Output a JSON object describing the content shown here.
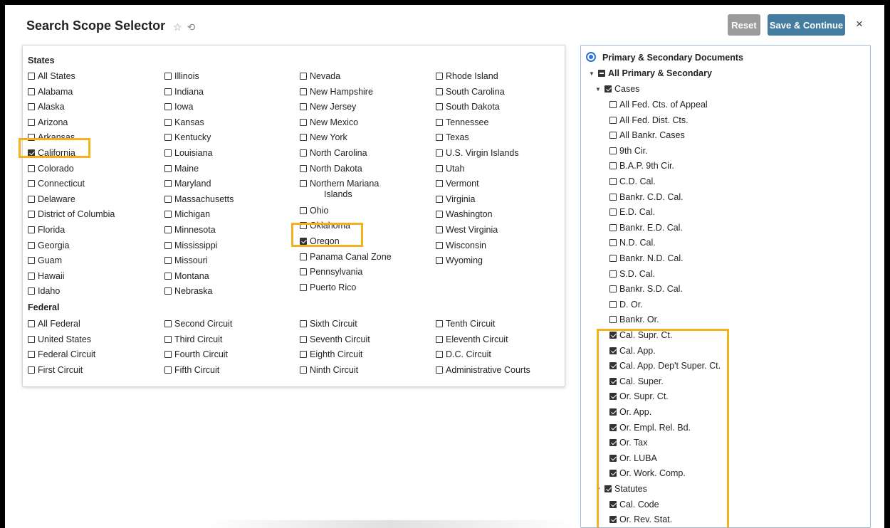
{
  "header": {
    "title": "Search Scope Selector",
    "star_icon": "star-icon",
    "history_icon": "history-icon",
    "reset_label": "Reset",
    "save_label": "Save & Continue",
    "close_label": "×"
  },
  "states": {
    "heading": "States",
    "col1": [
      {
        "label": "All States",
        "checked": false
      },
      {
        "label": "Alabama",
        "checked": false
      },
      {
        "label": "Alaska",
        "checked": false
      },
      {
        "label": "Arizona",
        "checked": false
      },
      {
        "label": "Arkansas",
        "checked": false
      },
      {
        "label": "California",
        "checked": true
      },
      {
        "label": "Colorado",
        "checked": false
      },
      {
        "label": "Connecticut",
        "checked": false
      },
      {
        "label": "Delaware",
        "checked": false
      },
      {
        "label": "District of Columbia",
        "checked": false
      },
      {
        "label": "Florida",
        "checked": false
      },
      {
        "label": "Georgia",
        "checked": false
      },
      {
        "label": "Guam",
        "checked": false
      },
      {
        "label": "Hawaii",
        "checked": false
      },
      {
        "label": "Idaho",
        "checked": false
      }
    ],
    "col2": [
      {
        "label": "Illinois",
        "checked": false
      },
      {
        "label": "Indiana",
        "checked": false
      },
      {
        "label": "Iowa",
        "checked": false
      },
      {
        "label": "Kansas",
        "checked": false
      },
      {
        "label": "Kentucky",
        "checked": false
      },
      {
        "label": "Louisiana",
        "checked": false
      },
      {
        "label": "Maine",
        "checked": false
      },
      {
        "label": "Maryland",
        "checked": false
      },
      {
        "label": "Massachusetts",
        "checked": false
      },
      {
        "label": "Michigan",
        "checked": false
      },
      {
        "label": "Minnesota",
        "checked": false
      },
      {
        "label": "Mississippi",
        "checked": false
      },
      {
        "label": "Missouri",
        "checked": false
      },
      {
        "label": "Montana",
        "checked": false
      },
      {
        "label": "Nebraska",
        "checked": false
      }
    ],
    "col3": [
      {
        "label": "Nevada",
        "checked": false
      },
      {
        "label": "New Hampshire",
        "checked": false
      },
      {
        "label": "New Jersey",
        "checked": false
      },
      {
        "label": "New Mexico",
        "checked": false
      },
      {
        "label": "New York",
        "checked": false
      },
      {
        "label": "North Carolina",
        "checked": false
      },
      {
        "label": "North Dakota",
        "checked": false
      },
      {
        "label": "Northern Mariana",
        "label2": "Islands",
        "checked": false
      },
      {
        "label": "Ohio",
        "checked": false
      },
      {
        "label": "Oklahoma",
        "checked": false
      },
      {
        "label": "Oregon",
        "checked": true
      },
      {
        "label": "Panama Canal Zone",
        "checked": false
      },
      {
        "label": "Pennsylvania",
        "checked": false
      },
      {
        "label": "Puerto Rico",
        "checked": false
      }
    ],
    "col4": [
      {
        "label": "Rhode Island",
        "checked": false
      },
      {
        "label": "South Carolina",
        "checked": false
      },
      {
        "label": "South Dakota",
        "checked": false
      },
      {
        "label": "Tennessee",
        "checked": false
      },
      {
        "label": "Texas",
        "checked": false
      },
      {
        "label": "U.S. Virgin Islands",
        "checked": false
      },
      {
        "label": "Utah",
        "checked": false
      },
      {
        "label": "Vermont",
        "checked": false
      },
      {
        "label": "Virginia",
        "checked": false
      },
      {
        "label": "Washington",
        "checked": false
      },
      {
        "label": "West Virginia",
        "checked": false
      },
      {
        "label": "Wisconsin",
        "checked": false
      },
      {
        "label": "Wyoming",
        "checked": false
      }
    ]
  },
  "federal": {
    "heading": "Federal",
    "col1": [
      {
        "label": "All Federal",
        "checked": false
      },
      {
        "label": "United States",
        "checked": false
      },
      {
        "label": "Federal Circuit",
        "checked": false
      },
      {
        "label": "First Circuit",
        "checked": false
      }
    ],
    "col2": [
      {
        "label": "Second Circuit",
        "checked": false
      },
      {
        "label": "Third Circuit",
        "checked": false
      },
      {
        "label": "Fourth Circuit",
        "checked": false
      },
      {
        "label": "Fifth Circuit",
        "checked": false
      }
    ],
    "col3": [
      {
        "label": "Sixth Circuit",
        "checked": false
      },
      {
        "label": "Seventh Circuit",
        "checked": false
      },
      {
        "label": "Eighth Circuit",
        "checked": false
      },
      {
        "label": "Ninth Circuit",
        "checked": false
      }
    ],
    "col4": [
      {
        "label": "Tenth Circuit",
        "checked": false
      },
      {
        "label": "Eleventh Circuit",
        "checked": false
      },
      {
        "label": "D.C. Circuit",
        "checked": false
      },
      {
        "label": "Administrative Courts",
        "checked": false
      }
    ]
  },
  "tree": {
    "radio_label": "Primary & Secondary Documents",
    "root": {
      "label": "All Primary & Secondary",
      "state": "partial"
    },
    "cases": {
      "label": "Cases",
      "state": "checked"
    },
    "case_items": [
      {
        "label": "All Fed. Cts. of Appeal",
        "checked": false
      },
      {
        "label": "All Fed. Dist. Cts.",
        "checked": false
      },
      {
        "label": "All Bankr. Cases",
        "checked": false
      },
      {
        "label": "9th Cir.",
        "checked": false
      },
      {
        "label": "B.A.P. 9th Cir.",
        "checked": false
      },
      {
        "label": "C.D. Cal.",
        "checked": false
      },
      {
        "label": "Bankr. C.D. Cal.",
        "checked": false
      },
      {
        "label": "E.D. Cal.",
        "checked": false
      },
      {
        "label": "Bankr. E.D. Cal.",
        "checked": false
      },
      {
        "label": "N.D. Cal.",
        "checked": false
      },
      {
        "label": "Bankr. N.D. Cal.",
        "checked": false
      },
      {
        "label": "S.D. Cal.",
        "checked": false
      },
      {
        "label": "Bankr. S.D. Cal.",
        "checked": false
      },
      {
        "label": "D. Or.",
        "checked": false
      },
      {
        "label": "Bankr. Or.",
        "checked": false
      },
      {
        "label": "Cal. Supr. Ct.",
        "checked": true
      },
      {
        "label": "Cal. App.",
        "checked": true
      },
      {
        "label": "Cal. App. Dep't Super. Ct.",
        "checked": true
      },
      {
        "label": "Cal. Super.",
        "checked": true
      },
      {
        "label": "Or. Supr. Ct.",
        "checked": true
      },
      {
        "label": "Or. App.",
        "checked": true
      },
      {
        "label": "Or. Empl. Rel. Bd.",
        "checked": true
      },
      {
        "label": "Or. Tax",
        "checked": true
      },
      {
        "label": "Or. LUBA",
        "checked": true
      },
      {
        "label": "Or. Work. Comp.",
        "checked": true
      }
    ],
    "statutes": {
      "label": "Statutes",
      "state": "checked"
    },
    "statute_items": [
      {
        "label": "Cal. Code",
        "checked": true
      },
      {
        "label": "Or. Rev. Stat.",
        "checked": true
      }
    ]
  },
  "colors": {
    "highlight": "#f2b21b",
    "save_button": "#457da0",
    "reset_button": "#9b9b9b",
    "radio": "#2f6fd6"
  }
}
